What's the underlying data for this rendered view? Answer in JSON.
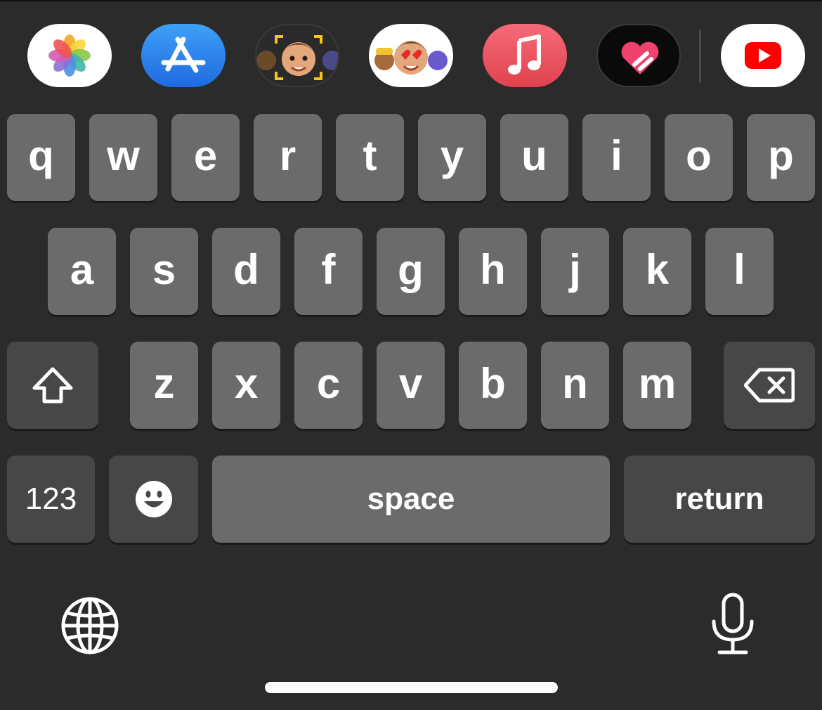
{
  "app_strip": {
    "apps": [
      {
        "name": "Photos",
        "icon": "photos-icon"
      },
      {
        "name": "App Store",
        "icon": "app-store-icon"
      },
      {
        "name": "Memoji Stickers Camera",
        "icon": "memoji-camera-icon"
      },
      {
        "name": "Memoji Stickers",
        "icon": "memoji-stickers-icon"
      },
      {
        "name": "Music",
        "icon": "music-icon"
      },
      {
        "name": "Digital Touch",
        "icon": "digital-touch-icon"
      },
      {
        "name": "YouTube",
        "icon": "youtube-icon"
      }
    ]
  },
  "keyboard": {
    "row1": [
      "q",
      "w",
      "e",
      "r",
      "t",
      "y",
      "u",
      "i",
      "o",
      "p"
    ],
    "row2": [
      "a",
      "s",
      "d",
      "f",
      "g",
      "h",
      "j",
      "k",
      "l"
    ],
    "row3": [
      "z",
      "x",
      "c",
      "v",
      "b",
      "n",
      "m"
    ],
    "shift_icon": "shift-icon",
    "delete_icon": "delete-icon",
    "numbers_label": "123",
    "emoji_icon": "emoji-icon",
    "space_label": "space",
    "return_label": "return"
  },
  "bottom_bar": {
    "globe_icon": "globe-icon",
    "mic_icon": "microphone-icon"
  },
  "colors": {
    "background": "#2b2b2b",
    "letter_key": "#6b6b6b",
    "function_key": "#474747",
    "key_text": "#ffffff"
  }
}
